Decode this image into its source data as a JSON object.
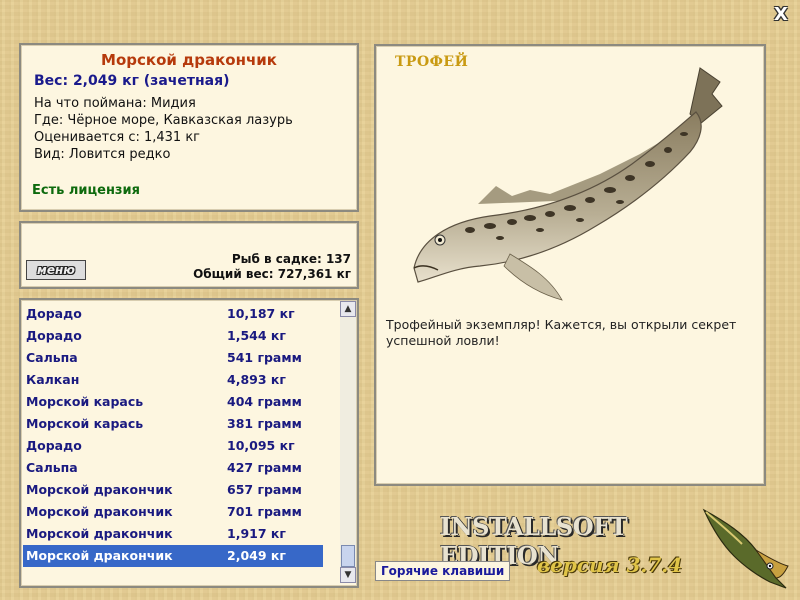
{
  "window": {
    "close_label": "X"
  },
  "fish": {
    "name": "Морской дракончик",
    "weight": "Вес: 2,049 кг (зачетная)",
    "bait": "На что поймана: Мидия",
    "location": "Где: Чёрное море, Кавказская лазурь",
    "rating": "Оценивается с: 1,431 кг",
    "kind": "Вид: Ловится редко",
    "license": "Есть лицензия"
  },
  "stats": {
    "menu_label": "меню",
    "count": "Рыб в садке: 137",
    "total_weight": "Общий вес: 727,361 кг"
  },
  "catch_list": [
    {
      "name": "Дорадо",
      "weight": "10,187 кг"
    },
    {
      "name": "Дорадо",
      "weight": "1,544 кг"
    },
    {
      "name": "Сальпа",
      "weight": "541 грамм"
    },
    {
      "name": "Калкан",
      "weight": "4,893 кг"
    },
    {
      "name": "Морской карась",
      "weight": "404 грамм"
    },
    {
      "name": "Морской карась",
      "weight": "381 грамм"
    },
    {
      "name": "Дорадо",
      "weight": "10,095 кг"
    },
    {
      "name": "Сальпа",
      "weight": "427 грамм"
    },
    {
      "name": "Морской дракончик",
      "weight": "657 грамм"
    },
    {
      "name": "Морской дракончик",
      "weight": "701 грамм"
    },
    {
      "name": "Морской дракончик",
      "weight": "1,917 кг"
    },
    {
      "name": "Морской дракончик",
      "weight": "2,049 кг"
    }
  ],
  "selected_index": 11,
  "trophy": {
    "label": "ТРОФЕЙ",
    "text": "Трофейный экземпляр! Кажется, вы открыли секрет успешной ловли!"
  },
  "branding": {
    "edition": "INSTALLSOFT EDITION",
    "version": "версия 3.7.4"
  },
  "hotkeys_label": "Горячие клавиши",
  "colors": {
    "selection": "#3768c8",
    "title": "#b63a0c",
    "license": "#0d6a0d"
  }
}
